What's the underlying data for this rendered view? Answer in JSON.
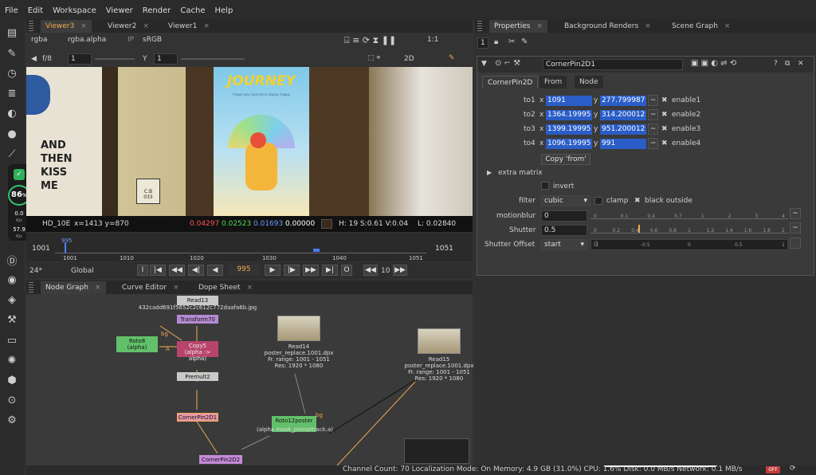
{
  "menu": [
    "File",
    "Edit",
    "Workspace",
    "Viewer",
    "Render",
    "Cache",
    "Help"
  ],
  "viewer_tabs": [
    "Viewer3",
    "Viewer2",
    "Viewer1"
  ],
  "viewer_toolbar": {
    "channels": "rgba",
    "alpha": "rgba.alpha",
    "ip": "IP",
    "colorspace": "sRGB",
    "zoom": "1:1",
    "fstop": "f/8",
    "fstop_val": "1",
    "gamma_label": "Y",
    "gamma_val": "1",
    "mode": "2D"
  },
  "image": {
    "poster_title": "JOURNEY",
    "poster_sub": "I hope your journey is always happy",
    "wall_text": "AND\nTHEN\nKISS\nME",
    "sign_text": "C.B\n033"
  },
  "viewer_status": {
    "format": "HD_10E",
    "coords": "x=1413 y=870",
    "r": "0.04297",
    "g": "0.02523",
    "b": "0.01693",
    "a": "0.00000",
    "hsv": "H: 19 S:0.61 V:0.04",
    "lum": "L: 0.02840"
  },
  "timeline": {
    "start": "1001",
    "end": "1051",
    "current": "995",
    "ticks": [
      "1001",
      "1010",
      "1020",
      "1030",
      "1040",
      "1051"
    ],
    "in_mark": "995",
    "fps": "24*",
    "scope": "Global",
    "step": "10"
  },
  "graph_tabs": [
    "Node Graph",
    "Curve Editor",
    "Dope Sheet"
  ],
  "nodes": {
    "read13": {
      "name": "Read13",
      "file": "432cadd691f5652c2c612c772daafa6b.jpg"
    },
    "transform70": "Transform70",
    "roto8": {
      "name": "Roto8",
      "sub": "(alpha)"
    },
    "copy5": {
      "name": "Copy5",
      "sub": "(alpha -> alpha)"
    },
    "premult2": "Premult2",
    "cornerpin2d1": "CornerPin2D1",
    "cornerpin2d2": "CornerPin2D2",
    "read14": {
      "name": "Read14",
      "file": "poster_replace.1001.dpx",
      "range": "Fr. range: 1001 - 1051",
      "res": "Res: 1920 * 1080"
    },
    "read15": {
      "name": "Read15",
      "file": "poster_replace.1001.dpx",
      "range": "Fr. range: 1001 - 1051",
      "res": "Res: 1920 * 1080"
    },
    "roto12": {
      "name": "Roto12poster",
      "sub": "(alpha mask_planartrack.a)"
    },
    "pin_a": "A",
    "pin_bg1": "bg",
    "pin_bg2": "bg"
  },
  "status_bar": "Channel Count: 70  Localization Mode: On  Memory: 4.9 GB (31.0%)  CPU: 1.6%  Disk: 0.0 MB/s  Network: 0.1 MB/s",
  "status_badge": "OFF",
  "hud": {
    "percent": "86",
    "percent_unit": "%",
    "up": "0.0",
    "up_unit": "K/s",
    "down": "57.9",
    "down_unit": "K/s"
  },
  "props_tabs": [
    "Properties",
    "Background Renders",
    "Scene Graph"
  ],
  "props": {
    "count": "1",
    "node_name": "CornerPin2D1",
    "sub_tabs": [
      "CornerPin2D",
      "From",
      "Node"
    ],
    "to_rows": [
      {
        "label": "to1",
        "x": "1091",
        "y": "277.799987",
        "enable": "enable1"
      },
      {
        "label": "to2",
        "x": "1364.19995",
        "y": "314.200012",
        "enable": "enable2"
      },
      {
        "label": "to3",
        "x": "1399.19995",
        "y": "951.200012",
        "enable": "enable3"
      },
      {
        "label": "to4",
        "x": "1096.19995",
        "y": "991",
        "enable": "enable4"
      }
    ],
    "copy_from": "Copy 'from'",
    "extra_matrix": "extra matrix",
    "invert": "invert",
    "filter_label": "filter",
    "filter_val": "cubic",
    "clamp": "clamp",
    "black_outside": "black outside",
    "motionblur_label": "motionblur",
    "motionblur_val": "0",
    "shutter_label": "Shutter",
    "shutter_val": "0.5",
    "shutter_offset_label": "Shutter Offset",
    "shutter_offset_val": "start",
    "shutter_offset_num": "0",
    "mb_ticks": [
      "0",
      "0.1",
      "0.4",
      "0.7",
      "1",
      "2",
      "3",
      "4"
    ],
    "sh_ticks": [
      "0",
      "0.2",
      "0.4",
      "0.6",
      "0.8",
      "1",
      "1.2",
      "1.4",
      "1.6",
      "1.8",
      "2"
    ],
    "so_ticks": [
      "-1",
      "-0.5",
      "0",
      "0.5",
      "1"
    ]
  }
}
